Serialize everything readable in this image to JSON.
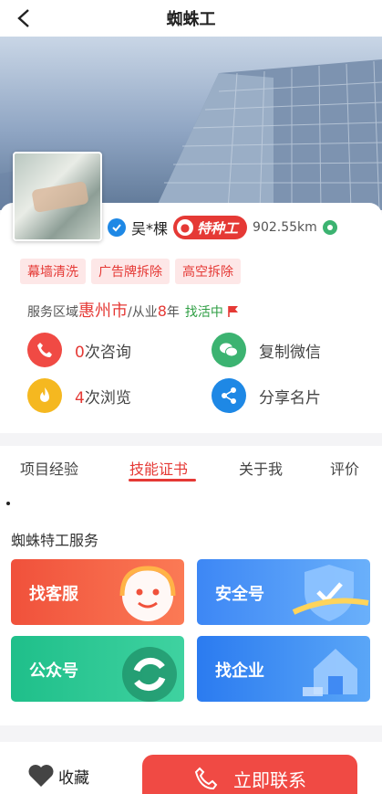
{
  "header": {
    "title": "蜘蛛工"
  },
  "profile": {
    "name": "吴*棵",
    "badge": "特种工",
    "distance": "902.55km"
  },
  "tags": [
    "幕墙清洗",
    "广告牌拆除",
    "高空拆除"
  ],
  "service": {
    "area_label": "服务区域",
    "city": "惠州市",
    "exp_prefix": "/从业",
    "years": "8",
    "exp_suffix": "年",
    "status": "找活中"
  },
  "actions": {
    "consult_count": "0",
    "consult_label": "次咨询",
    "browse_count": "4",
    "browse_label": "次浏览",
    "copy_wechat": "复制微信",
    "share_card": "分享名片"
  },
  "tabs": [
    "项目经验",
    "技能证书",
    "关于我",
    "评价"
  ],
  "active_tab": "技能证书",
  "section_title": "蜘蛛特工服务",
  "services": [
    "找客服",
    "安全号",
    "公众号",
    "找企业"
  ],
  "bottom": {
    "favorite": "收藏",
    "contact": "立即联系"
  },
  "colors": {
    "accent": "#e53935",
    "green": "#2e9e43",
    "consult": "#f04a44",
    "wechat": "#3cb371",
    "browse": "#f5b820",
    "share": "#1e88e5"
  }
}
